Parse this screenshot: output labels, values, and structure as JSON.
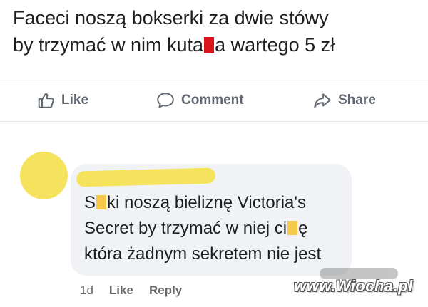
{
  "post": {
    "line1": "Faceci noszą bokserki za dwie stówy",
    "line2_before": "by trzymać w nim kuta",
    "line2_after": "a wartego 5 zł"
  },
  "actions": {
    "like_label": "Like",
    "comment_label": "Comment",
    "share_label": "Share"
  },
  "comment": {
    "text_part1": "S",
    "text_part2": "ki noszą bieliznę Victoria's Secret by trzymać w niej ci",
    "text_part3": "ę która żadnym sekretem nie jest",
    "time": "1d",
    "like_label": "Like",
    "reply_label": "Reply"
  },
  "watermark": "www.Wiocha.pl",
  "colors": {
    "censor_red": "#d9141b",
    "censor_yellow": "#f6c94a",
    "avatar_yellow": "#f6e35d",
    "bubble_bg": "#f0f2f5",
    "action_gray": "#606770"
  },
  "icons": {
    "like": "thumbs-up-icon",
    "comment": "speech-bubble-icon",
    "share": "share-arrow-icon"
  }
}
